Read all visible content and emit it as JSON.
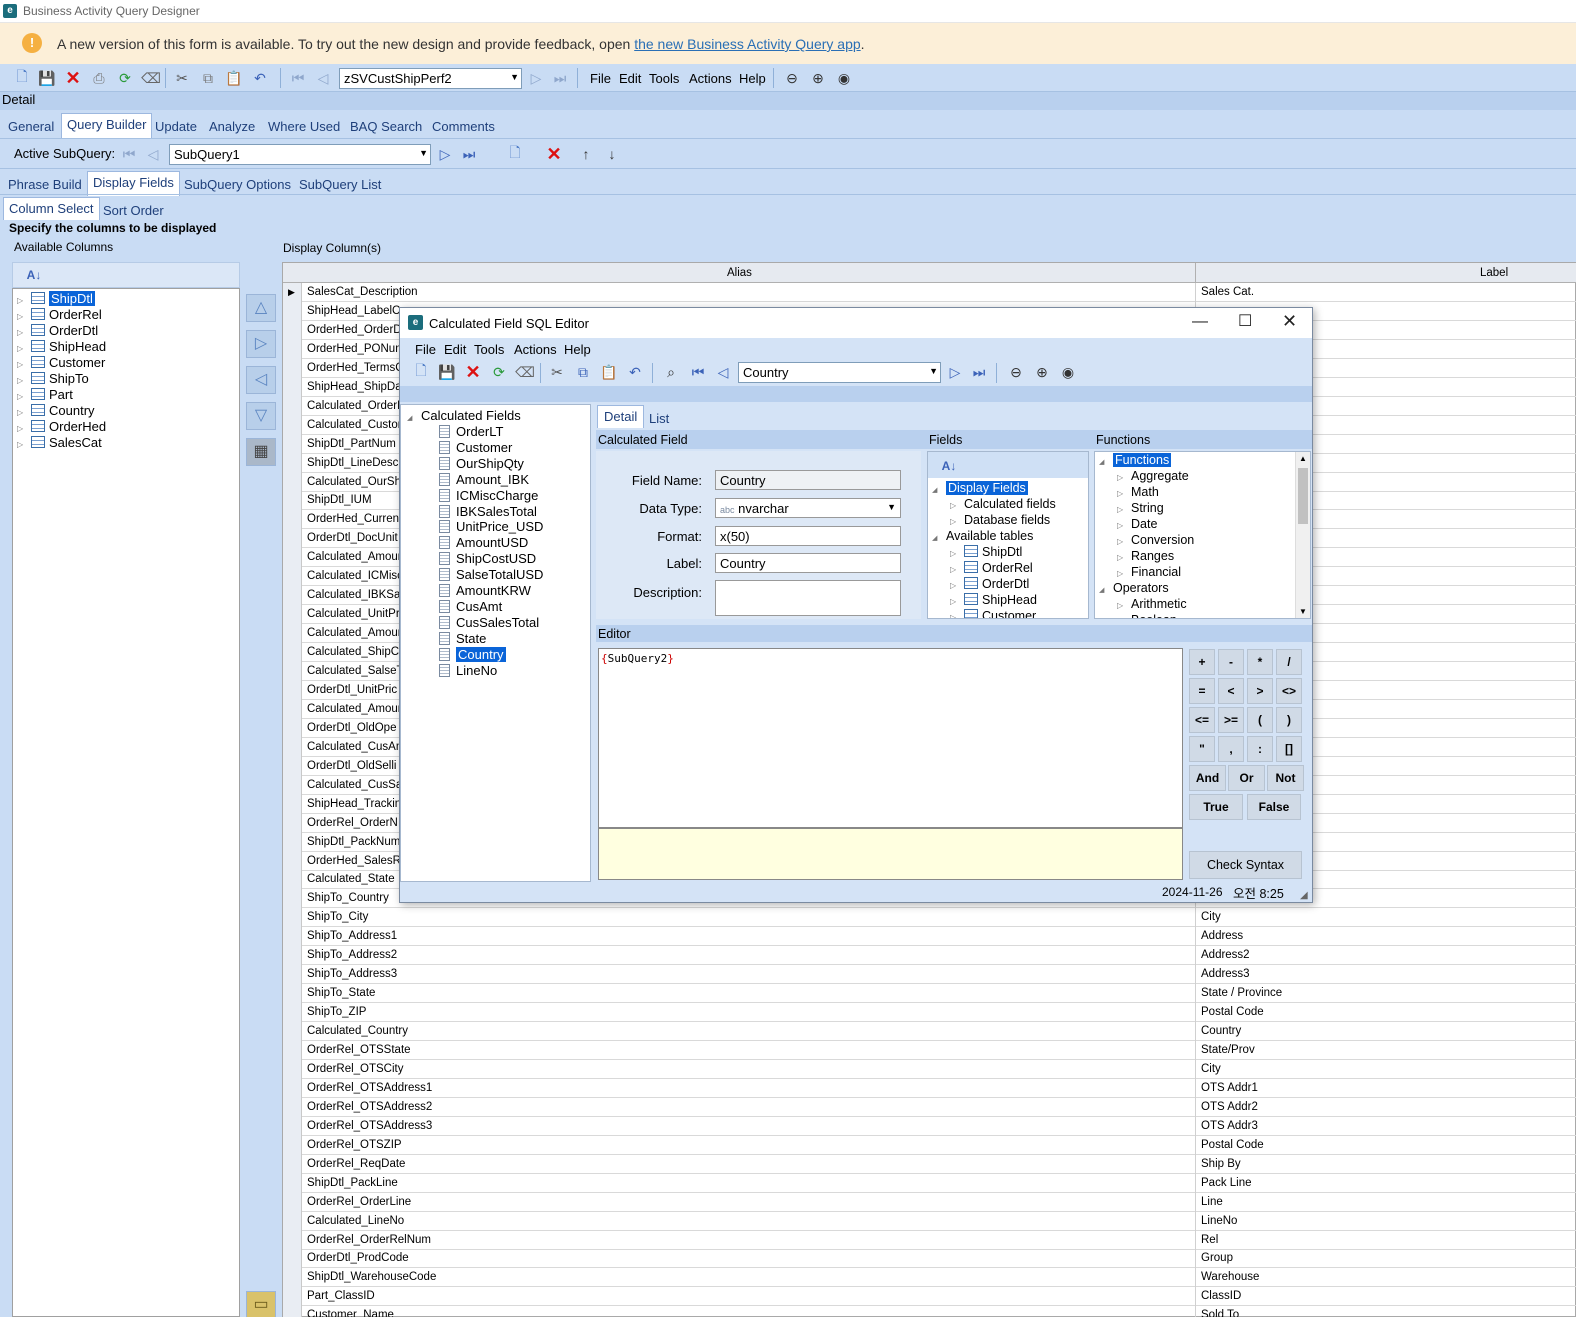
{
  "app": {
    "title": "Business Activity Query Designer"
  },
  "banner": {
    "text": "A new version of this form is available. To try out the new design and provide feedback, open ",
    "link": "the new Business Activity Query app",
    "end": "."
  },
  "toolbar": {
    "query_id": "zSVCustShipPerf2",
    "menus": [
      "File",
      "Edit",
      "Tools",
      "Actions",
      "Help"
    ]
  },
  "detail_label": "Detail",
  "main_tabs": [
    "General",
    "Query Builder",
    "Update",
    "Analyze",
    "Where Used",
    "BAQ Search",
    "Comments"
  ],
  "subquery": {
    "label": "Active SubQuery:",
    "value": "SubQuery1"
  },
  "sub_tabs": [
    "Phrase Build",
    "Display Fields",
    "SubQuery Options",
    "SubQuery List"
  ],
  "col_tabs": [
    "Column Select",
    "Sort Order"
  ],
  "instructions": "Specify the columns to be displayed",
  "available_label": "Available Columns",
  "display_label": "Display Column(s)",
  "tables": [
    "ShipDtl",
    "OrderRel",
    "OrderDtl",
    "ShipHead",
    "Customer",
    "ShipTo",
    "Part",
    "Country",
    "OrderHed",
    "SalesCat"
  ],
  "grid": {
    "headers": [
      "Alias",
      "Label"
    ],
    "rows": [
      [
        "SalesCat_Description",
        "Sales Cat."
      ],
      [
        "ShipHead_LabelC",
        ""
      ],
      [
        "OrderHed_OrderD",
        ""
      ],
      [
        "OrderHed_PONum",
        ""
      ],
      [
        "OrderHed_TermsC",
        ""
      ],
      [
        "ShipHead_ShipDa",
        ""
      ],
      [
        "Calculated_OrderL",
        ""
      ],
      [
        "Calculated_Custor",
        ""
      ],
      [
        "ShipDtl_PartNum",
        ""
      ],
      [
        "ShipDtl_LineDesc",
        ""
      ],
      [
        "Calculated_OurSh",
        ""
      ],
      [
        "ShipDtl_IUM",
        ""
      ],
      [
        "OrderHed_Curren",
        ""
      ],
      [
        "OrderDtl_DocUnit",
        ""
      ],
      [
        "Calculated_Amour",
        ""
      ],
      [
        "Calculated_ICMisc",
        ""
      ],
      [
        "Calculated_IBKSal",
        ""
      ],
      [
        "Calculated_UnitPr",
        ""
      ],
      [
        "Calculated_Amour",
        ""
      ],
      [
        "Calculated_ShipC",
        ""
      ],
      [
        "Calculated_SalseT",
        ""
      ],
      [
        "OrderDtl_UnitPric",
        ""
      ],
      [
        "Calculated_Amour",
        ""
      ],
      [
        "OrderDtl_OldOpe",
        "SD)"
      ],
      [
        "Calculated_CusAm",
        "D)"
      ],
      [
        "OrderDtl_OldSelli",
        "ost(USD)"
      ],
      [
        "Calculated_CusSa",
        "USD)"
      ],
      [
        "ShipHead_Trackin",
        ""
      ],
      [
        "OrderRel_OrderN",
        ""
      ],
      [
        "ShipDtl_PackNum",
        ""
      ],
      [
        "OrderHed_SalesR",
        ""
      ],
      [
        "Calculated_State",
        ""
      ],
      [
        "ShipTo_Country",
        ""
      ],
      [
        "ShipTo_City",
        "City"
      ],
      [
        "ShipTo_Address1",
        "Address"
      ],
      [
        "ShipTo_Address2",
        "Address2"
      ],
      [
        "ShipTo_Address3",
        "Address3"
      ],
      [
        "ShipTo_State",
        "State / Province"
      ],
      [
        "ShipTo_ZIP",
        "Postal Code"
      ],
      [
        "Calculated_Country",
        "Country"
      ],
      [
        "OrderRel_OTSState",
        "State/Prov"
      ],
      [
        "OrderRel_OTSCity",
        "City"
      ],
      [
        "OrderRel_OTSAddress1",
        "OTS Addr1"
      ],
      [
        "OrderRel_OTSAddress2",
        "OTS Addr2"
      ],
      [
        "OrderRel_OTSAddress3",
        "OTS Addr3"
      ],
      [
        "OrderRel_OTSZIP",
        "Postal Code"
      ],
      [
        "OrderRel_ReqDate",
        "Ship By"
      ],
      [
        "ShipDtl_PackLine",
        "Pack Line"
      ],
      [
        "OrderRel_OrderLine",
        "Line"
      ],
      [
        "Calculated_LineNo",
        "LineNo"
      ],
      [
        "OrderRel_OrderRelNum",
        "Rel"
      ],
      [
        "OrderDtl_ProdCode",
        "Group"
      ],
      [
        "ShipDtl_WarehouseCode",
        "Warehouse"
      ],
      [
        "Part_ClassID",
        "ClassID"
      ],
      [
        "Customer_Name",
        "Sold To"
      ]
    ]
  },
  "dialog": {
    "title": "Calculated Field SQL Editor",
    "menus": [
      "File",
      "Edit",
      "Tools",
      "Actions",
      "Help"
    ],
    "nav_value": "Country",
    "tabs": [
      "Detail",
      "List"
    ],
    "tree_root": "Calculated Fields",
    "calc_fields": [
      "OrderLT",
      "Customer",
      "OurShipQty",
      "Amount_IBK",
      "ICMiscCharge",
      "IBKSalesTotal",
      "UnitPrice_USD",
      "AmountUSD",
      "ShipCostUSD",
      "SalseTotalUSD",
      "AmountKRW",
      "CusAmt",
      "CusSalesTotal",
      "State",
      "Country",
      "LineNo"
    ],
    "section_calc": "Calculated Field",
    "section_fields": "Fields",
    "section_functions": "Functions",
    "field_name_label": "Field Name:",
    "field_name": "Country",
    "data_type_label": "Data Type:",
    "data_type_prefix": "abc",
    "data_type": "nvarchar",
    "format_label": "Format:",
    "format": "x(50)",
    "label_label": "Label:",
    "label": "Country",
    "description_label": "Description:",
    "fields_tree": {
      "display": "Display Fields",
      "display_children": [
        "Calculated fields",
        "Database fields"
      ],
      "available": "Available tables",
      "tables": [
        "ShipDtl",
        "OrderRel",
        "OrderDtl",
        "ShipHead",
        "Customer"
      ]
    },
    "functions_tree": {
      "root": "Functions",
      "items": [
        "Aggregate",
        "Math",
        "String",
        "Date",
        "Conversion",
        "Ranges",
        "Financial"
      ],
      "operators": "Operators",
      "op_items": [
        "Arithmetic",
        "Boolean"
      ]
    },
    "editor_label": "Editor",
    "editor_text": "{SubQuery2}",
    "keys": [
      "+",
      "-",
      "*",
      "/",
      "=",
      "<",
      ">",
      "<>",
      "<=",
      ">=",
      "(",
      ")",
      "\"",
      ",",
      ":",
      "[]"
    ],
    "logic": [
      "And",
      "Or",
      "Not"
    ],
    "bools": [
      "True",
      "False"
    ],
    "check_syntax": "Check Syntax",
    "status_date": "2024-11-26",
    "status_time": "오전 8:25"
  }
}
